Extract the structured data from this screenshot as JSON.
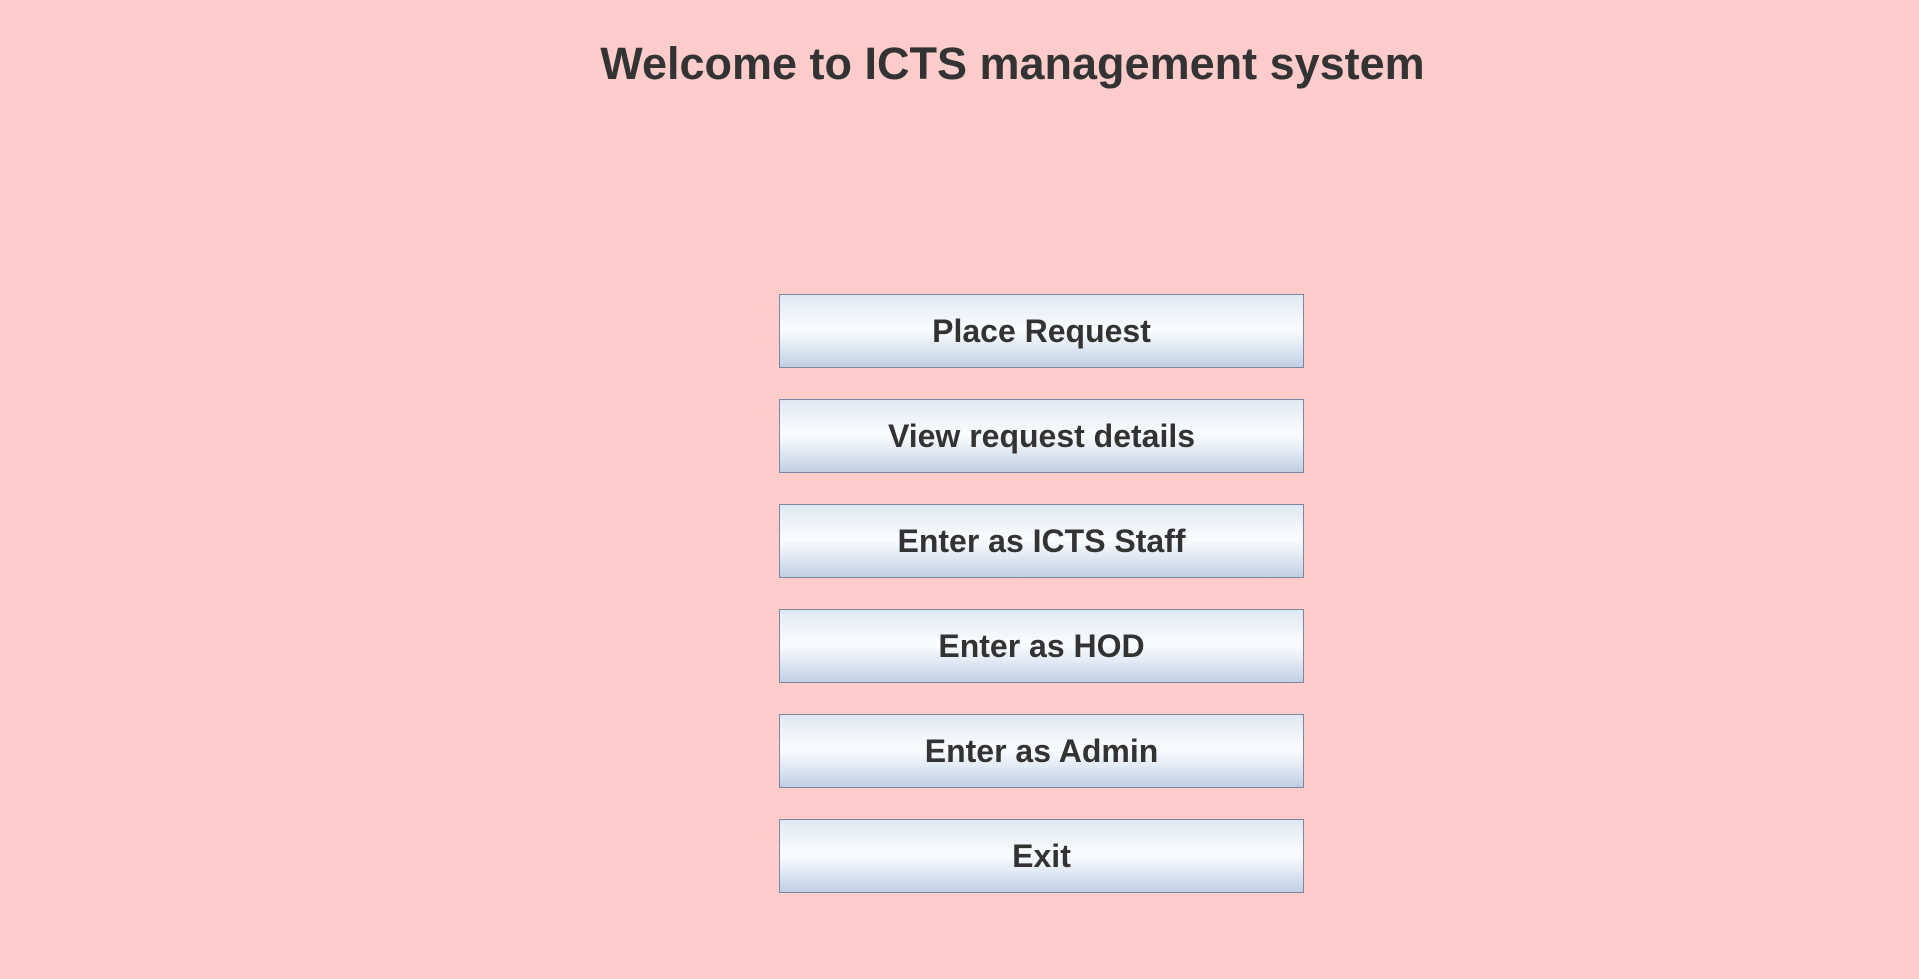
{
  "header": {
    "title": "Welcome to ICTS management system"
  },
  "menu": {
    "buttons": [
      {
        "label": "Place Request"
      },
      {
        "label": "View request details"
      },
      {
        "label": "Enter as ICTS Staff"
      },
      {
        "label": "Enter as HOD"
      },
      {
        "label": "Enter as Admin"
      },
      {
        "label": "Exit"
      }
    ]
  },
  "colors": {
    "background": "#ffcccc",
    "text": "#333333",
    "button_border": "#7a8a9e"
  }
}
